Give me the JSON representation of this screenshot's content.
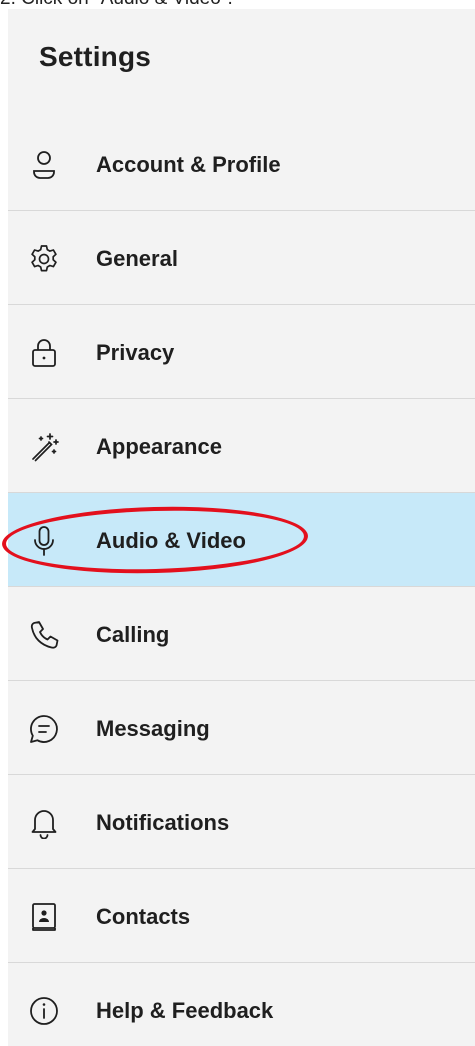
{
  "caption": "2. Click on \"Audio & Video\".",
  "settings": {
    "title": "Settings",
    "items": [
      {
        "label": "Account & Profile",
        "icon": "person-icon"
      },
      {
        "label": "General",
        "icon": "gear-icon"
      },
      {
        "label": "Privacy",
        "icon": "lock-icon"
      },
      {
        "label": "Appearance",
        "icon": "magic-wand-icon"
      },
      {
        "label": "Audio & Video",
        "icon": "microphone-icon",
        "selected": true
      },
      {
        "label": "Calling",
        "icon": "phone-icon"
      },
      {
        "label": "Messaging",
        "icon": "chat-bubble-icon"
      },
      {
        "label": "Notifications",
        "icon": "bell-icon"
      },
      {
        "label": "Contacts",
        "icon": "contact-card-icon"
      },
      {
        "label": "Help & Feedback",
        "icon": "info-icon"
      }
    ]
  },
  "colors": {
    "panel_bg": "#f3f3f3",
    "selected_bg": "#c7e9f9",
    "highlight_ring": "#e3101d",
    "text": "#1f1f1f"
  }
}
